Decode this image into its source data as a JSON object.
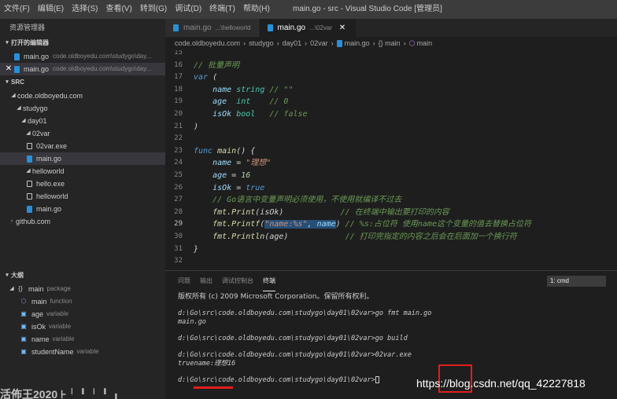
{
  "menu": [
    "文件(F)",
    "编辑(E)",
    "选择(S)",
    "查看(V)",
    "转到(G)",
    "调试(D)",
    "终端(T)",
    "帮助(H)"
  ],
  "window_title": "main.go - src - Visual Studio Code [管理员]",
  "sidebar": {
    "header": "资源管理器",
    "open_editors_label": "打开的编辑器",
    "open_editors": [
      {
        "name": "main.go",
        "path": "code.oldboyedu.com\\studygo\\day..."
      },
      {
        "name": "main.go",
        "path": "code.oldboyedu.com\\studygo\\day..."
      }
    ],
    "src_label": "SRC",
    "tree": {
      "root": "code.oldboyedu.com",
      "studygo": "studygo",
      "day01": "day01",
      "f02var": "02var",
      "f02var_exe": "02var.exe",
      "f02var_main": "main.go",
      "helloworld": "helloworld",
      "hello_exe": "hello.exe",
      "helloworld_bin": "helloworld",
      "helloworld_main": "main.go",
      "github": "github.com"
    },
    "outline_label": "大纲",
    "outline": {
      "main_pkg": {
        "name": "main",
        "kind": "package"
      },
      "main_func": {
        "name": "main",
        "kind": "function"
      },
      "age": {
        "name": "age",
        "kind": "variable"
      },
      "isOk": {
        "name": "isOk",
        "kind": "variable"
      },
      "name": {
        "name": "name",
        "kind": "variable"
      },
      "studentName": {
        "name": "studentName",
        "kind": "variable"
      }
    }
  },
  "tabs": [
    {
      "name": "main.go",
      "desc": "...\\helloworld"
    },
    {
      "name": "main.go",
      "desc": "...\\02var"
    }
  ],
  "breadcrumb": [
    "code.oldboyedu.com",
    "studygo",
    "day01",
    "02var",
    "main.go",
    "{} main",
    "main"
  ],
  "code": {
    "current_line": 29,
    "line_numbers": [
      "15",
      "16",
      "17",
      "18",
      "19",
      "20",
      "21",
      "22",
      "23",
      "24",
      "25",
      "26",
      "27",
      "28",
      "29",
      "30",
      "31",
      "32"
    ],
    "l16_comment": "// 批量声明",
    "l17_var": "var",
    "l17_paren": " (",
    "l18_id": "name",
    "l18_type": "string",
    "l18_comment": "// \"\"",
    "l19_id": "age",
    "l19_type": "int",
    "l19_comment": "// 0",
    "l20_id": "isOk",
    "l20_type": "bool",
    "l20_comment": "// false",
    "l21_close": ")",
    "l23_func": "func",
    "l23_name": "main",
    "l23_rest": "() {",
    "l24_id": "name",
    "l24_op": " = ",
    "l24_val": "\"理想\"",
    "l25_id": "age",
    "l25_op": " = ",
    "l25_val": "16",
    "l26_id": "isOk",
    "l26_op": " = ",
    "l26_val": "true",
    "l27_comment": "// Go语言中变量声明必须使用，不使用就编译不过去",
    "l28_call": "fmt.Print",
    "l28_args": "(isOk)",
    "l28_comment": "// 在终端中输出要打印的内容",
    "l29_call": "fmt.Printf",
    "l29_open": "(",
    "l29_str": "\"name:%s\"",
    "l29_sep": ", ",
    "l29_arg": "name",
    "l29_close": ")",
    "l29_comment": "// %s:占位符 使用name这个变量的值去替换占位符",
    "l30_call": "fmt.Println",
    "l30_args": "(age)",
    "l30_comment": "// 打印完指定的内容之后会在后面加一个换行符",
    "l31_close": "}"
  },
  "panel": {
    "tabs": [
      "问题",
      "输出",
      "调试控制台",
      "终端"
    ],
    "terminal_select": "1: cmd",
    "terminal_lines": [
      "版权所有 (c) 2009 Microsoft Corporation。保留所有权利。",
      "",
      "d:\\Go\\src\\code.oldboyedu.com\\studygo\\day01\\02var>go fmt main.go",
      "main.go",
      "",
      "d:\\Go\\src\\code.oldboyedu.com\\studygo\\day01\\02var>go build",
      "",
      "d:\\Go\\src\\code.oldboyedu.com\\studygo\\day01\\02var>02var.exe",
      "truename:理想16",
      "",
      "d:\\Go\\src\\code.oldboyedu.com\\studygo\\day01\\02var>"
    ]
  },
  "watermark": "https://blog.csdn.net/qq_42227818",
  "overlay_text": "活佈王2020 ⊦╵╹╵╹╻"
}
